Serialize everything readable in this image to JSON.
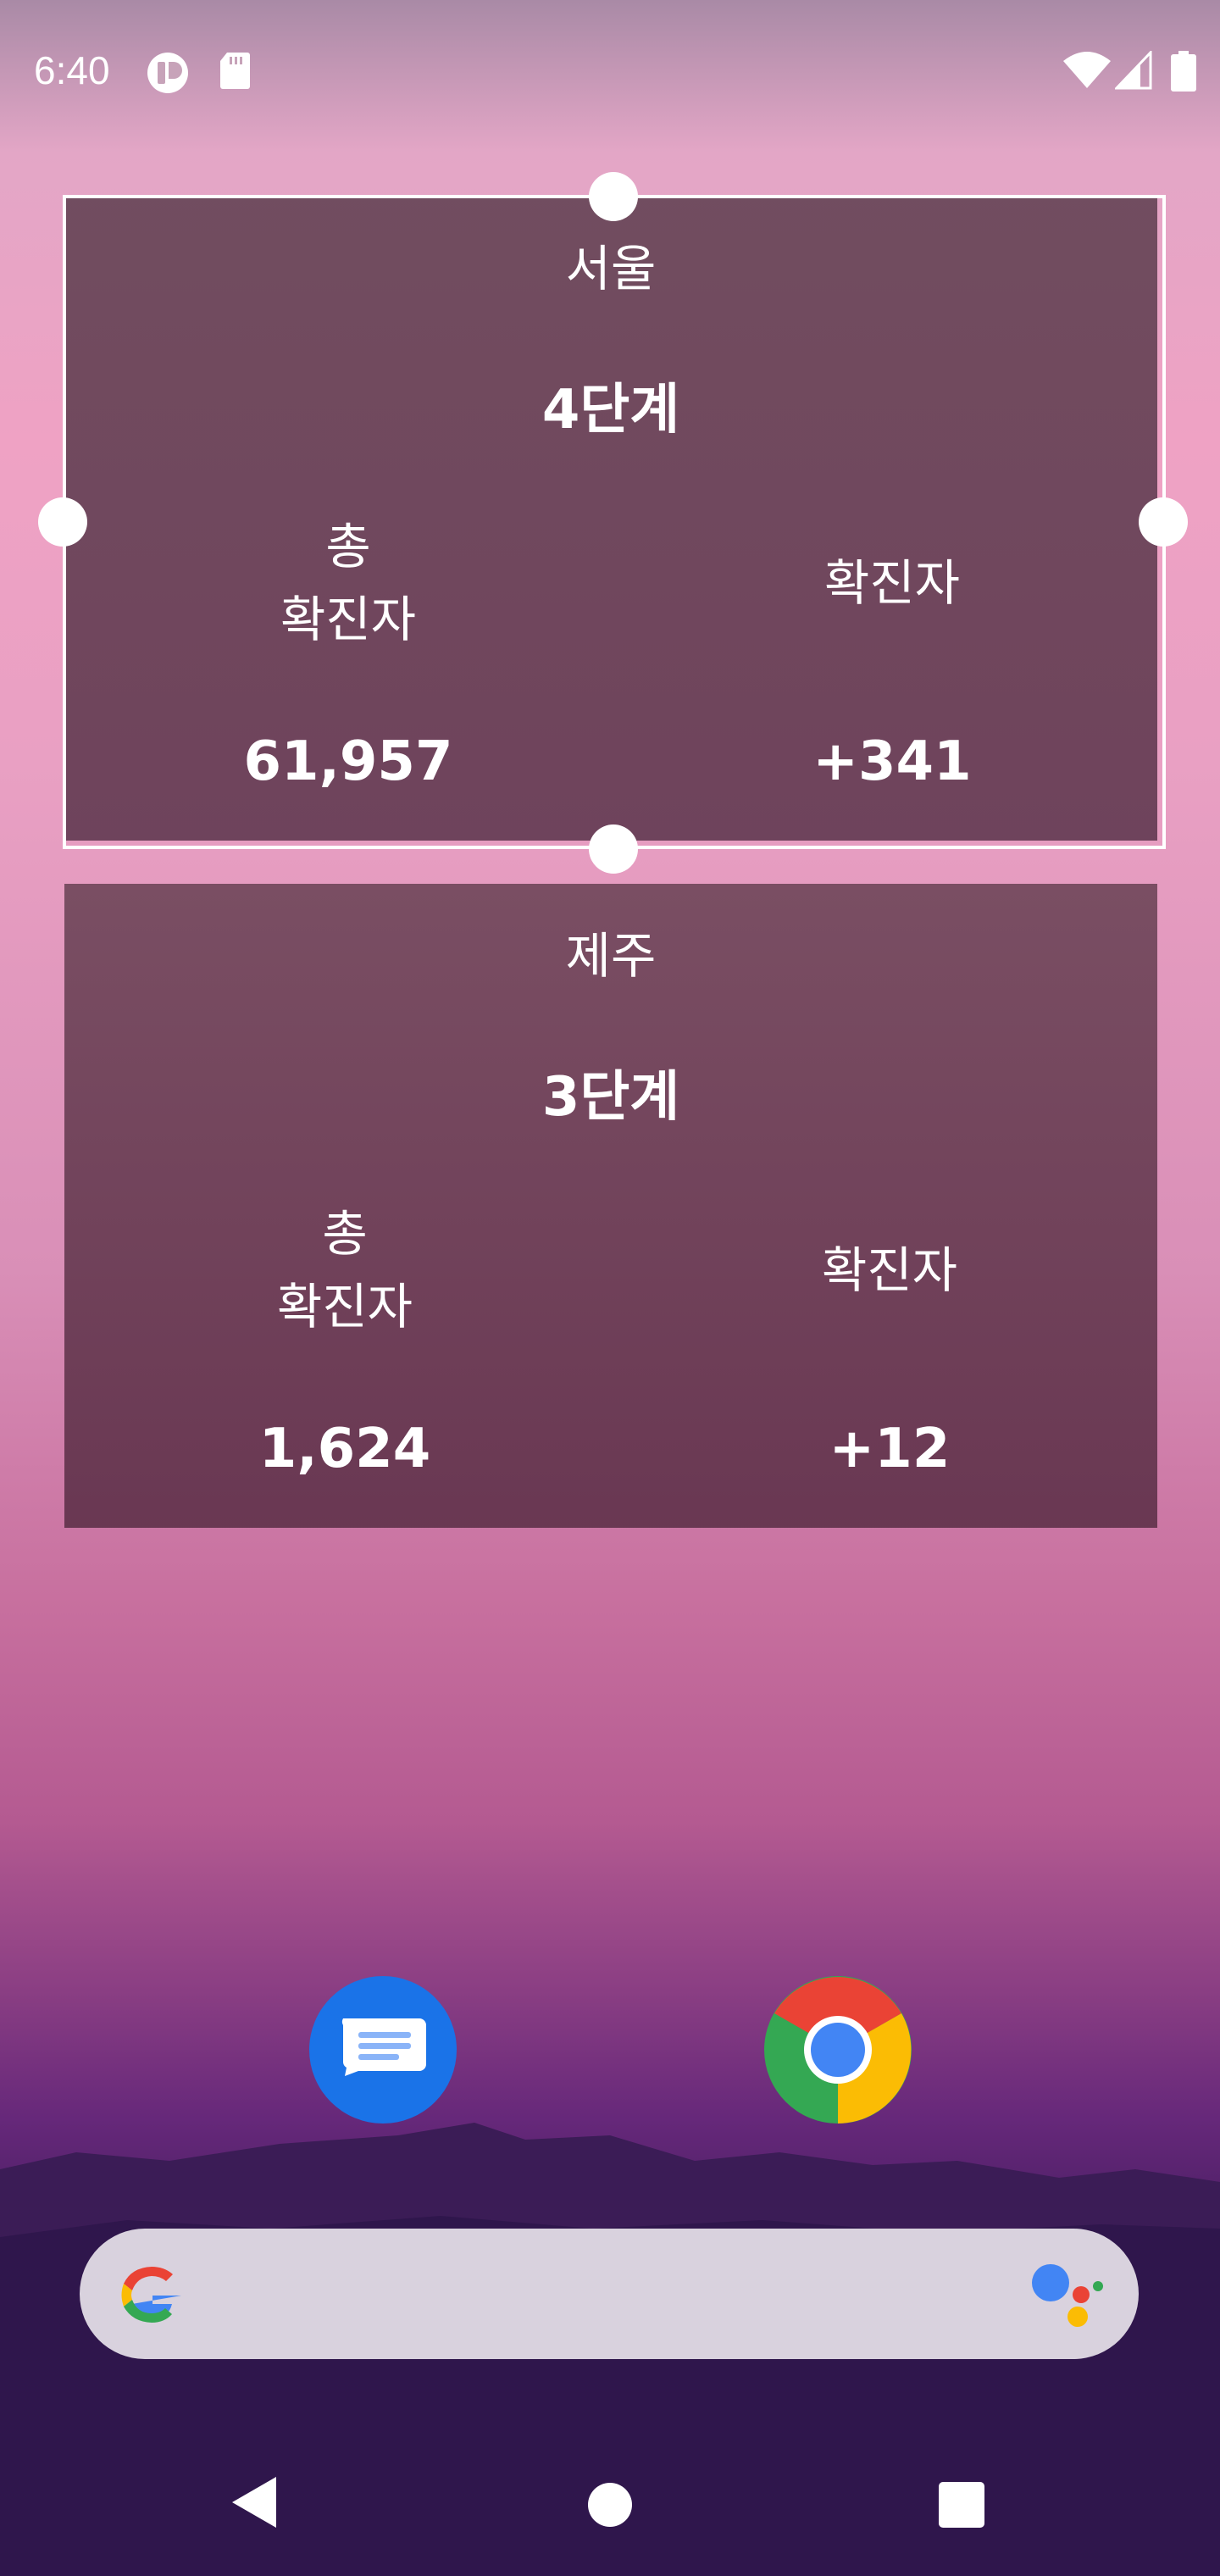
{
  "status_bar": {
    "time": "6:40",
    "icons": [
      "app-notification-icon",
      "sd-card-icon",
      "wifi-icon",
      "cell-signal-icon",
      "battery-icon"
    ]
  },
  "widgets": [
    {
      "region": "서울",
      "level": "4단계",
      "total_label_line1": "총",
      "total_label_line2": "확진자",
      "total_value": "61,957",
      "new_label": "확진자",
      "new_value": "+341"
    },
    {
      "region": "제주",
      "level": "3단계",
      "total_label_line1": "총",
      "total_label_line2": "확진자",
      "total_value": "1,624",
      "new_label": "확진자",
      "new_value": "+12"
    }
  ],
  "dock": {
    "apps": [
      "messages-icon",
      "chrome-icon"
    ]
  },
  "search": {
    "icons": [
      "google-g-icon",
      "google-assistant-icon"
    ]
  },
  "colors": {
    "widget_bg": "#6b485a",
    "messages_blue": "#1a73e8",
    "search_bg": "#d9d2de"
  }
}
